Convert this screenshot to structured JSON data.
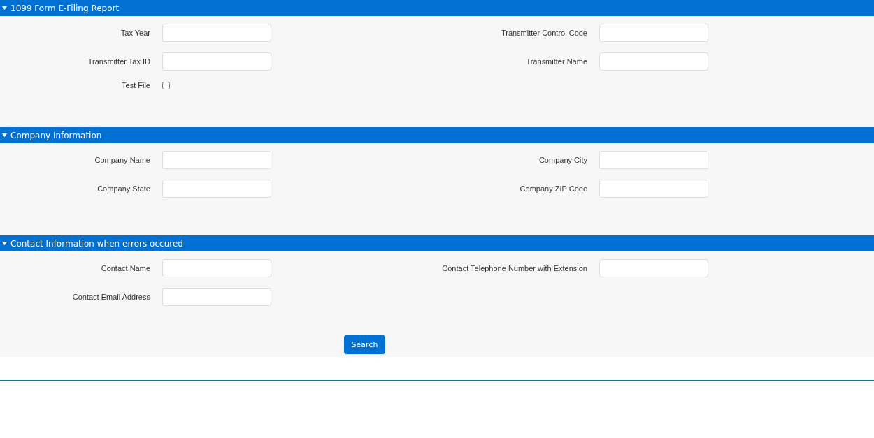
{
  "sections": [
    {
      "title": "1099 Form E-Filing Report",
      "expanded": true,
      "fields": [
        {
          "kind": "text",
          "label": "Tax Year"
        },
        {
          "kind": "text",
          "label": "Transmitter Control Code"
        },
        {
          "kind": "text",
          "label": "Transmitter Tax ID"
        },
        {
          "kind": "text",
          "label": "Transmitter Name"
        },
        {
          "kind": "checkbox",
          "label": "Test File",
          "checked": false
        }
      ]
    },
    {
      "title": "Company Information",
      "expanded": true,
      "fields": [
        {
          "kind": "text",
          "label": "Company Name"
        },
        {
          "kind": "text",
          "label": "Company City"
        },
        {
          "kind": "text",
          "label": "Company State"
        },
        {
          "kind": "text",
          "label": "Company ZIP Code"
        }
      ]
    },
    {
      "title": "Contact Information when errors occured",
      "expanded": true,
      "fields": [
        {
          "kind": "text",
          "label": "Contact Name"
        },
        {
          "kind": "text",
          "label": "Contact Telephone Number with Extension"
        },
        {
          "kind": "text",
          "label": "Contact Email Address"
        }
      ]
    }
  ],
  "search_button": "Search"
}
